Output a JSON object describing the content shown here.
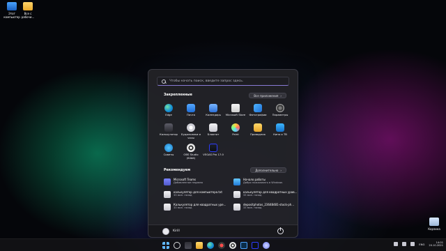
{
  "desktop": {
    "icons": [
      {
        "label": "Этот компьютер",
        "icon": "pc-icon"
      },
      {
        "label": "Все с рабочи...",
        "icon": "folder-icon"
      }
    ],
    "recycle_bin": {
      "label": "Корзина",
      "icon": "recycle-bin-icon"
    }
  },
  "start_menu": {
    "search_placeholder": "Чтобы начать поиск, введите запрос здесь.",
    "pinned_title": "Закрепленные",
    "all_apps_label": "Все приложения",
    "pinned_apps": [
      {
        "label": "Edge",
        "icon": "edge-icon"
      },
      {
        "label": "Почта",
        "icon": "mail-icon"
      },
      {
        "label": "Календарь",
        "icon": "calendar-icon"
      },
      {
        "label": "Microsoft Store",
        "icon": "store-icon"
      },
      {
        "label": "Фотографии",
        "icon": "photos-icon"
      },
      {
        "label": "Параметры",
        "icon": "settings-icon"
      },
      {
        "label": "Калькулятор",
        "icon": "calculator-icon"
      },
      {
        "label": "Будильники и часы",
        "icon": "alarm-icon"
      },
      {
        "label": "Блокнот",
        "icon": "notepad-icon"
      },
      {
        "label": "Paint",
        "icon": "paint-icon"
      },
      {
        "label": "Проводник",
        "icon": "explorer-icon"
      },
      {
        "label": "Кино и ТВ",
        "icon": "movies-icon"
      },
      {
        "label": "Советы",
        "icon": "tips-icon"
      },
      {
        "label": "OBS Studio (64bit)",
        "icon": "obs-icon"
      },
      {
        "label": "VEGAS Pro 17.0",
        "icon": "vegas-icon"
      }
    ],
    "recommended_title": "Рекомендуем",
    "more_label": "Дополнительно",
    "recommended": [
      {
        "title": "Microsoft Teams",
        "subtitle": "Добавленное недавно",
        "icon": "teams-icon"
      },
      {
        "title": "Начало работы",
        "subtitle": "Добро пожаловать в Windows",
        "icon": "get-started-icon"
      },
      {
        "title": "калькулятор для компьютера.txt",
        "subtitle": "33 мин. назад",
        "icon": "document-icon"
      },
      {
        "title": "калькулятор для квадратных урав...",
        "subtitle": "33 мин. назад",
        "icon": "document-icon"
      },
      {
        "title": "Калькулятор для квадратных уре...",
        "subtitle": "33 мин. назад",
        "icon": "document-icon"
      },
      {
        "title": "depositphotos_23648481-stock-ph...",
        "subtitle": "33 мин. назад",
        "icon": "document-icon"
      }
    ],
    "user_name": "Kirill"
  },
  "taskbar": {
    "lang": "ENG",
    "time": "14:01",
    "date": "20.10.2021"
  }
}
